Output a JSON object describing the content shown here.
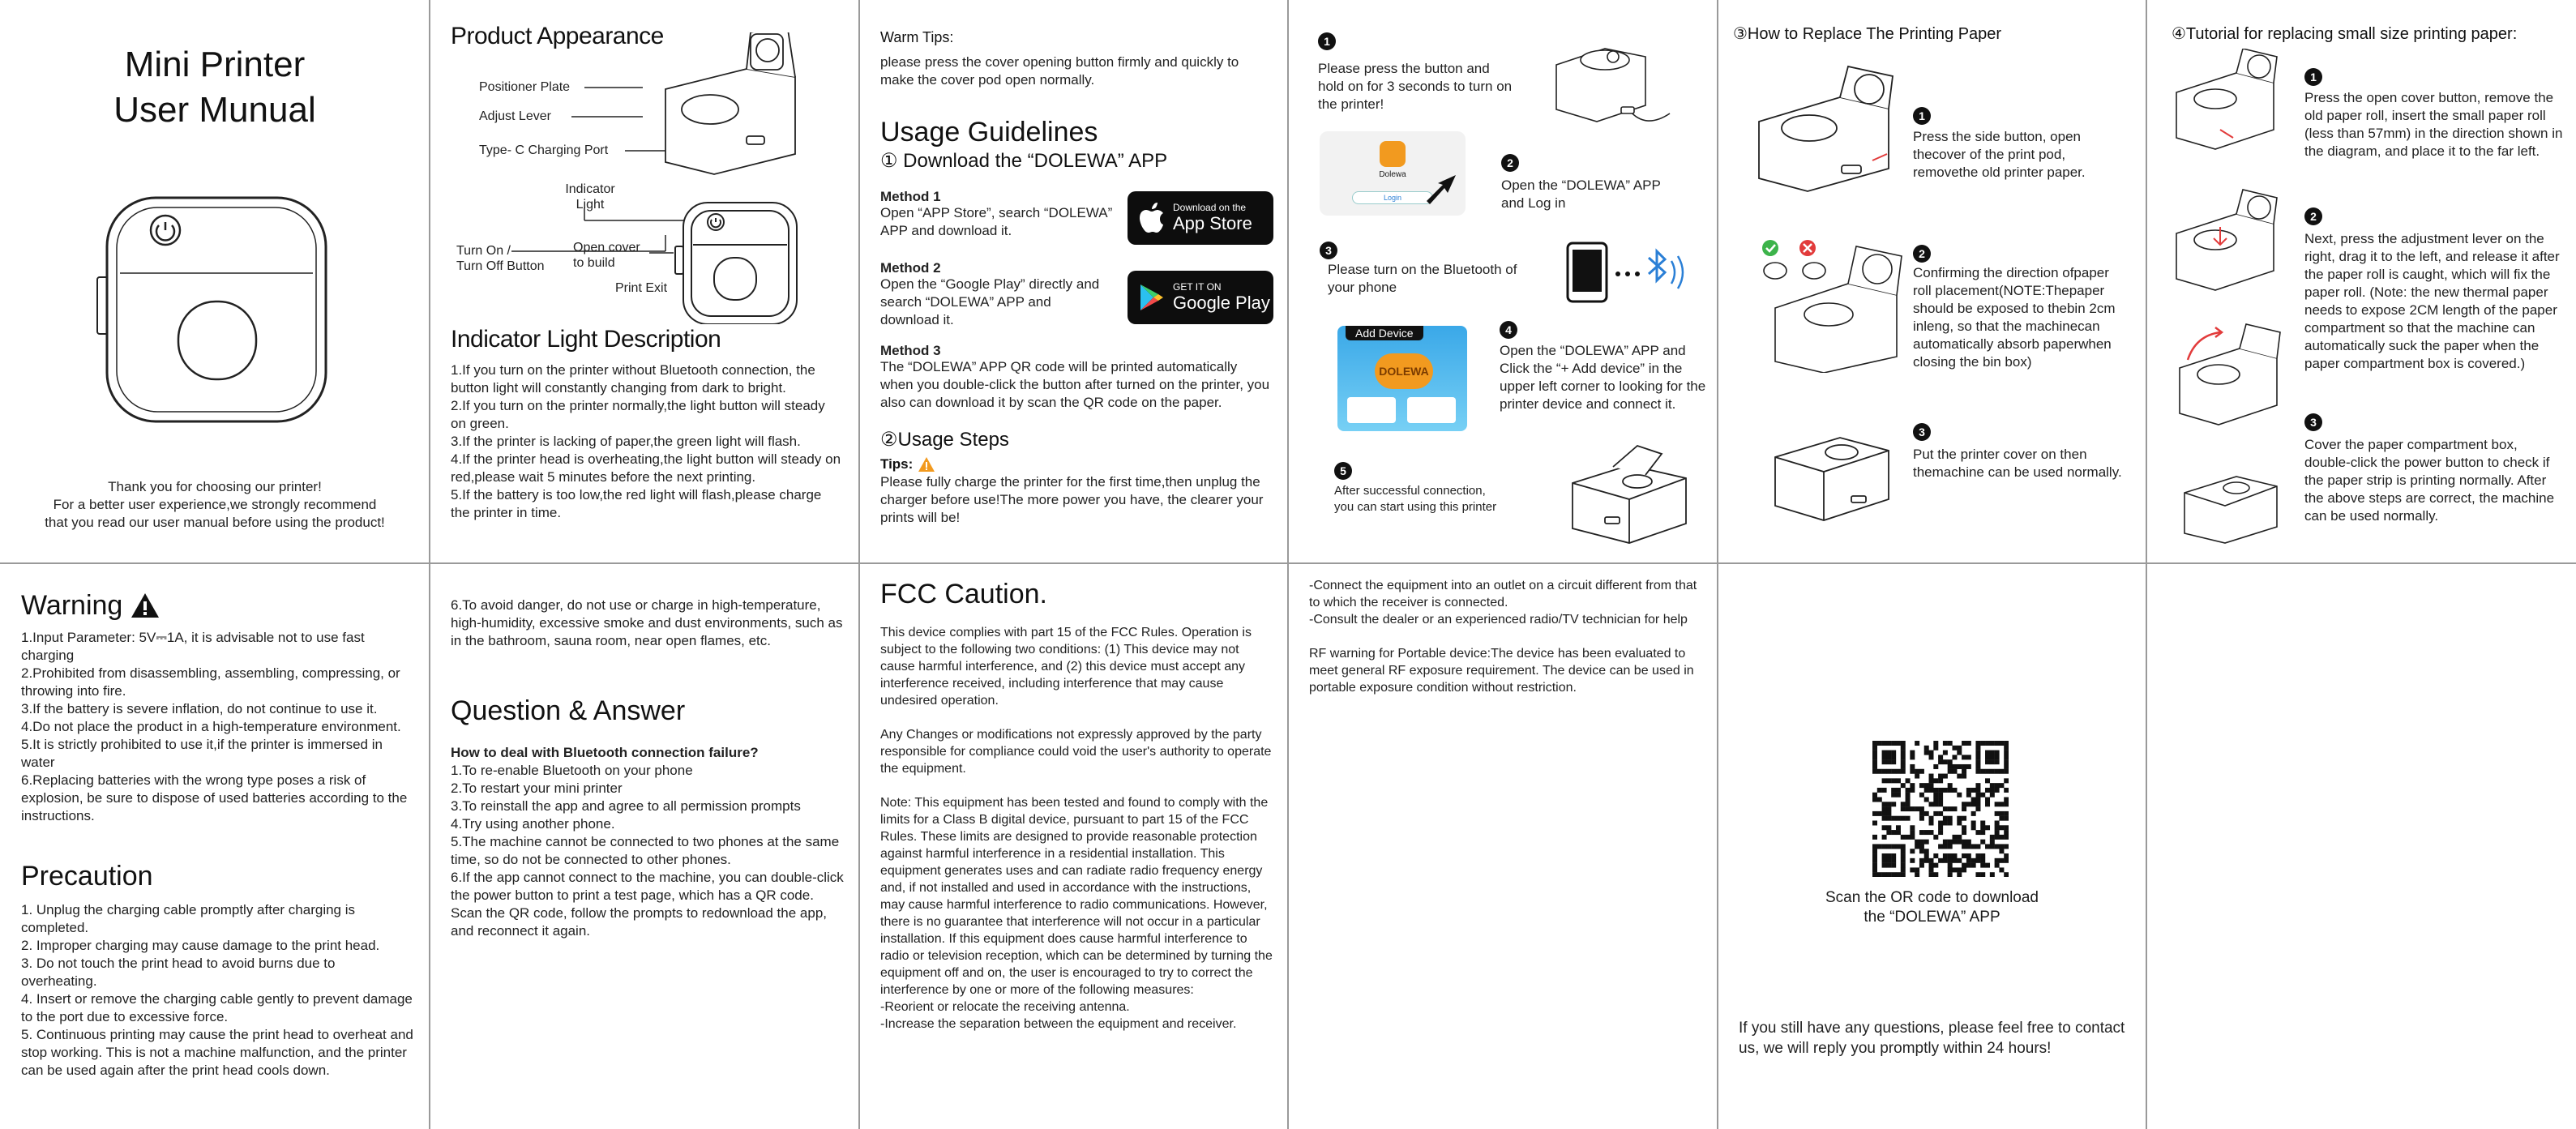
{
  "cover": {
    "title_line1": "Mini Printer",
    "title_line2": "User Munual",
    "thanks1": "Thank you for choosing our printer!",
    "thanks2": "For a better user experience,we strongly recommend",
    "thanks3": "that you read our user manual before using the product!"
  },
  "appearance": {
    "title": "Product Appearance",
    "labels": {
      "positioner": "Positioner Plate",
      "adjust": "Adjust Lever",
      "typec": "Type- C Charging Port",
      "indicator1": "Indicator",
      "indicator2": "Light",
      "turn1": "Turn On /",
      "turn2": "Turn Off Button",
      "cover1": "Open cover",
      "cover2": "to build",
      "exit": "Print Exit"
    },
    "indicator_title": "Indicator Light Description",
    "indicator_text": [
      "1.If you turn on the printer without Bluetooth connection, the button light will constantly changing from dark to bright.",
      "2.If you turn on the printer normally,the light button will steady on green.",
      "3.If the printer is lacking of paper,the green light will flash.",
      "4.If the printer head is overheating,the light button will steady on red,please wait 5 minutes before the next printing.",
      "5.If the battery is too low,the red light will flash,please charge the printer in time."
    ]
  },
  "usage": {
    "warm_title": "Warm Tips:",
    "warm_text": "please press the cover opening button firmly and quickly to make the cover pod open normally.",
    "title": "Usage Guidelines",
    "sub1": "① Download the “DOLEWA” APP",
    "m1_title": "Method 1",
    "m1_text": "Open “APP Store”, search “DOLEWA” APP and download it.",
    "m2_title": "Method 2",
    "m2_text": "Open the “Google Play” directly and search “DOLEWA” APP and download it.",
    "m3_title": "Method 3",
    "m3_text": "The “DOLEWA” APP QR code will be printed automatically when you double-click the button after turned on the printer, you also can download it by scan the QR code on the paper.",
    "appstore_small": "Download on the",
    "appstore_big": "App Store",
    "gplay_small": "GET IT ON",
    "gplay_big": "Google Play",
    "sub2": "②Usage Steps",
    "tips_label": "Tips:",
    "tips_text": "Please fully charge the printer for the first time,then unplug the charger before use!The more power you have, the clearer your prints will be!"
  },
  "steps": {
    "s1": "Please press the button and hold on for 3 seconds to turn on the printer!",
    "s2": "Open the “DOLEWA” APP and Log in",
    "s3": "Please turn on the Bluetooth of your phone",
    "s4": "Open the “DOLEWA” APP and Click the “+ Add device” in the upper left corner to looking for the printer device and connect it.",
    "s5a": "After successful connection,",
    "s5b": "you can start using this printer",
    "app_name": "Dolewa",
    "login": "Login",
    "add_device": "Add Device",
    "brand": "DOLEWA"
  },
  "replace": {
    "title": "③How to Replace The Printing Paper",
    "r1": "Press the side button, open thecover of the print pod, removethe old printer paper.",
    "r2": "Confirming the direction ofpaper roll placement(NOTE:Thepaper should be exposed to thebin 2cm inleng, so that the machinecan automatically absorb paperwhen closing the bin box)",
    "r3": "Put the printer cover on then themachine can be used normally."
  },
  "tutorial": {
    "title": "④Tutorial for replacing small size printing paper:",
    "t1": "Press the open cover button, remove the old paper roll, insert the small paper roll (less than 57mm) in the direction shown in the diagram, and place it to the far left.",
    "t2": "Next, press the adjustment lever on the right, drag it to the left, and release it after the paper roll is caught, which will fix the paper roll. (Note: the new thermal paper needs to expose 2CM length of the paper compartment so that the machine can automatically suck the paper when the paper compartment box is covered.)",
    "t3": "Cover the paper compartment box, double-click the power button to check if the paper strip is printing normally. After the above steps are correct, the machine can be used normally."
  },
  "warning": {
    "title": "Warning",
    "items": [
      "1.Input Parameter: 5V⎓1A, it is advisable not to use fast charging",
      "2.Prohibited from disassembling, assembling, compressing, or throwing into fire.",
      "3.If the battery is severe inflation, do not continue to use it.",
      "4.Do not place the product in a high-temperature environment.",
      "5.It is strictly prohibited to use it,if the printer is immersed in water",
      "6.Replacing batteries with the wrong type poses a risk of explosion, be sure to dispose of used batteries according to the instructions."
    ],
    "precaution_title": "Precaution",
    "precautions": [
      "1. Unplug the charging cable promptly after charging is completed.",
      "2. Improper charging may cause damage to the print head.",
      "3. Do not touch the print head to avoid burns due to overheating.",
      "4. Insert or remove the charging cable gently to prevent damage to the port due to excessive force.",
      "5. Continuous printing may cause the print head to overheat and stop working. This is not a machine malfunction, and the printer can be used again after the print head cools down."
    ]
  },
  "qa": {
    "item6": "6.To avoid danger, do not use or charge in high-temperature, high-humidity, excessive smoke and dust environments, such as in the bathroom, sauna room, near open flames, etc.",
    "title": "Question & Answer",
    "q": "How to deal with Bluetooth connection failure?",
    "answers": [
      "1.To re-enable Bluetooth on your phone",
      "2.To restart your mini printer",
      "3.To reinstall the app and agree to all permission prompts",
      "4.Try using another phone.",
      "5.The machine cannot be connected to two phones at the same time, so do not be connected to other phones.",
      "6.If the app cannot connect to the machine, you can double-click the power button to print a test page, which has a QR code. Scan the QR code, follow the prompts to redownload the app, and reconnect it again."
    ]
  },
  "fcc": {
    "title": "FCC Caution.",
    "p1": "This device complies with part 15 of the FCC Rules. Operation is subject to the following two conditions: (1) This device may not cause harmful interference, and (2) this device must accept any interference received, including interference that may cause undesired operation.",
    "p2": "Any Changes or modifications not expressly approved by the party responsible for compliance could void the user's authority to operate the equipment.",
    "p3": "Note: This equipment has been tested and found to comply with the limits for a Class B digital device, pursuant to part 15 of the FCC Rules. These limits are designed to provide reasonable protection against harmful interference in a residential installation. This equipment generates uses and can radiate radio frequency energy and, if not installed and used in accordance with the instructions, may cause harmful interference to radio communications. However, there is no guarantee that interference will not occur in a particular installation. If this equipment does cause harmful interference to radio or television reception, which can be determined by turning the equipment off and on, the user is encouraged to try to correct the interference by one or more of the following measures:",
    "b1": "-Reorient or relocate the receiving antenna.",
    "b2": "-Increase the separation between the equipment and receiver."
  },
  "fcc2": {
    "b3": "-Connect the equipment into an outlet on a circuit different from that to which the receiver is connected.",
    "b4": "-Consult the dealer or an experienced radio/TV technician for help",
    "rf": "RF warning for Portable device:The device has been evaluated to meet general RF exposure requirement. The device can be used in portable exposure condition without restriction."
  },
  "contact": {
    "qr_line1": "Scan the OR code to download",
    "qr_line2": "the “DOLEWA” APP",
    "footer": "If you still have any questions, please feel free to contact us, we will reply you promptly within 24 hours!"
  },
  "icons": {
    "warning": "warning-triangle-icon",
    "apple": "apple-icon",
    "google_play": "google-play-icon",
    "bluetooth": "bluetooth-icon",
    "phone": "phone-icon",
    "power": "power-icon",
    "check": "check-icon",
    "cross": "cross-icon"
  },
  "colors": {
    "accent_orange": "#f29a1f",
    "blue": "#2a7fd6",
    "green": "#3cb34a",
    "red": "#e23b3b"
  }
}
